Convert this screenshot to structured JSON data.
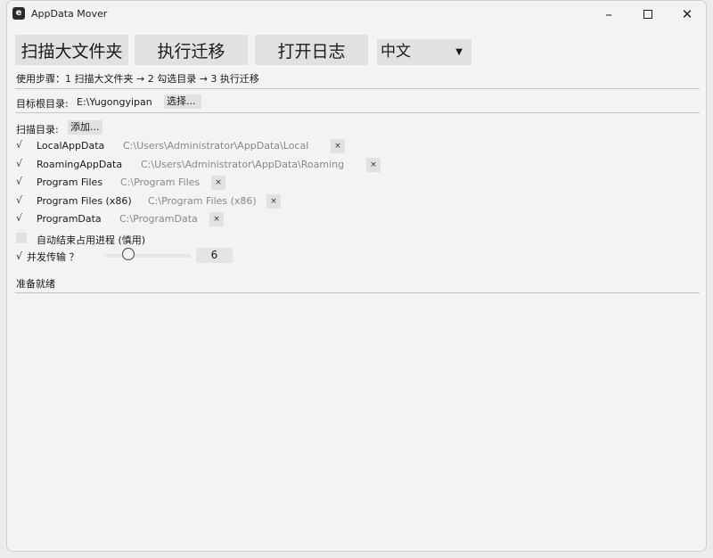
{
  "window": {
    "title": "AppData Mover",
    "icon_letter": "e",
    "controls": {
      "minimize": "–",
      "maximize": "☐",
      "close": "✕"
    }
  },
  "toolbar": {
    "scan_label": "扫描大文件夹",
    "migrate_label": "执行迁移",
    "open_log_label": "打开日志",
    "language": {
      "selected": "中文",
      "arrow": "▼"
    }
  },
  "hint": "使用步骤：1 扫描大文件夹 → 2 勾选目录 → 3 执行迁移",
  "target": {
    "label": "目标根目录:",
    "path": "E:\\Yugongyipan",
    "choose_label": "选择..."
  },
  "scan": {
    "label": "扫描目录:",
    "add_label": "添加...",
    "dirs": [
      {
        "checked": "√",
        "name": "LocalAppData",
        "path": "C:\\Users\\Administrator\\AppData\\Local",
        "remove": "×"
      },
      {
        "checked": "√",
        "name": "RoamingAppData",
        "path": "C:\\Users\\Administrator\\AppData\\Roaming",
        "remove": "×"
      },
      {
        "checked": "√",
        "name": "Program Files",
        "path": "C:\\Program Files",
        "remove": "×"
      },
      {
        "checked": "√",
        "name": "Program Files (x86)",
        "path": "C:\\Program Files (x86)",
        "remove": "×"
      },
      {
        "checked": "√",
        "name": "ProgramData",
        "path": "C:\\ProgramData",
        "remove": "×"
      }
    ]
  },
  "options": {
    "auto_kill_label": "自动结束占用进程 (慎用)",
    "concurrent_check": "√",
    "concurrent_label": "并发传输 ？",
    "concurrency_value": "6"
  },
  "status": "准备就绪"
}
